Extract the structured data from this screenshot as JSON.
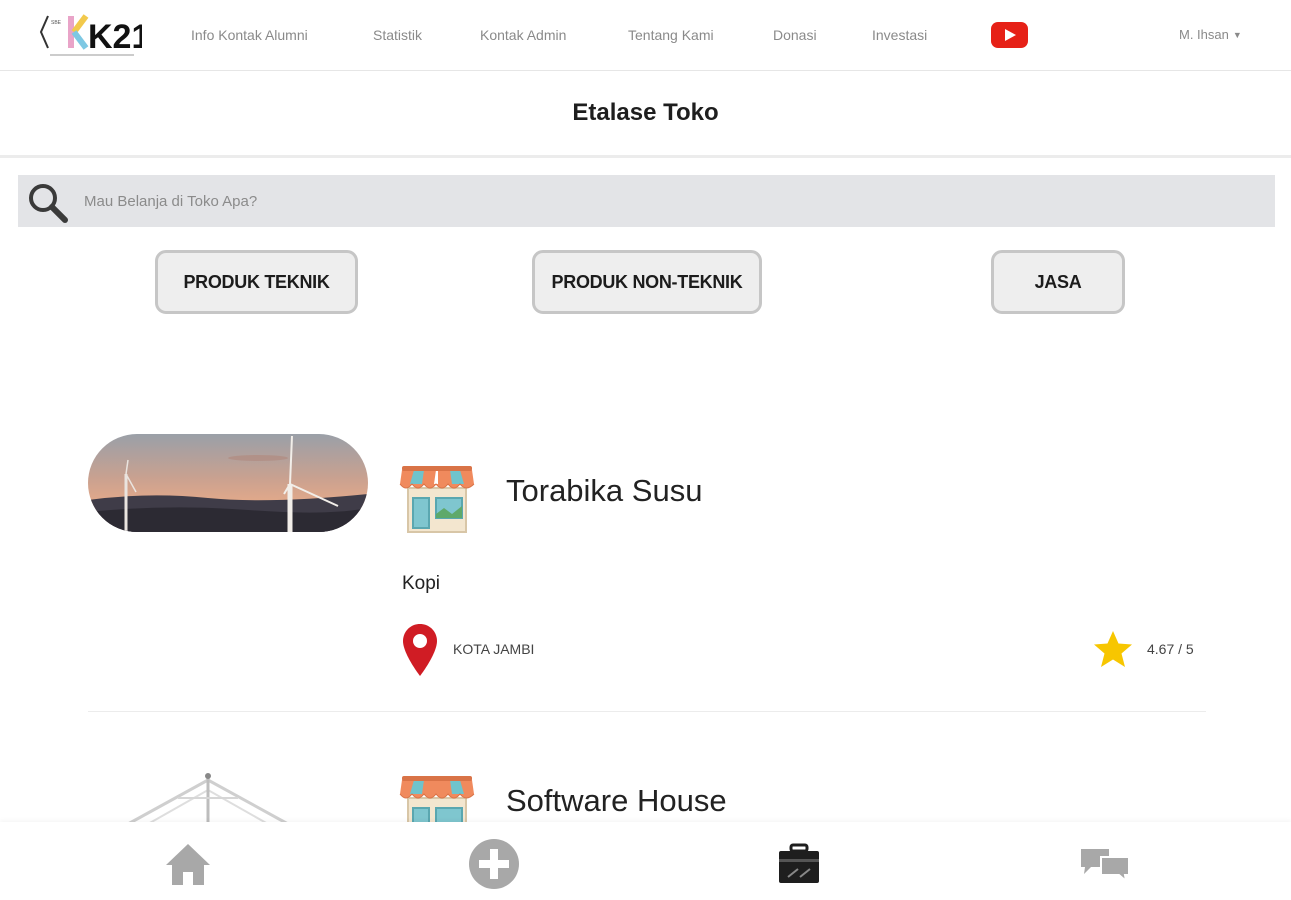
{
  "nav": {
    "logo_text": "K21",
    "links": [
      "Info Kontak Alumni",
      "Statistik",
      "Kontak Admin",
      "Tentang Kami",
      "Donasi",
      "Investasi"
    ],
    "youtube_icon": "youtube-icon",
    "user_name": "M. Ihsan"
  },
  "page": {
    "title": "Etalase Toko"
  },
  "search": {
    "placeholder": "Mau Belanja di Toko Apa?",
    "value": ""
  },
  "categories": [
    "PRODUK TEKNIK",
    "PRODUK NON-TEKNIK",
    "JASA"
  ],
  "stores": [
    {
      "name": "Torabika Susu",
      "category": "Kopi",
      "city": "KOTA JAMBI",
      "rating": "4.67 / 5"
    },
    {
      "name": "Software House"
    }
  ],
  "bottom_nav": {
    "items": [
      "home-icon",
      "add-circle-icon",
      "briefcase-icon",
      "chat-icon"
    ]
  },
  "colors": {
    "youtube": "#e62117",
    "pin": "#d01c24",
    "star": "#f7c600",
    "search_bg": "#e3e4e7",
    "nav_icon_gray": "#a8a8a8"
  }
}
